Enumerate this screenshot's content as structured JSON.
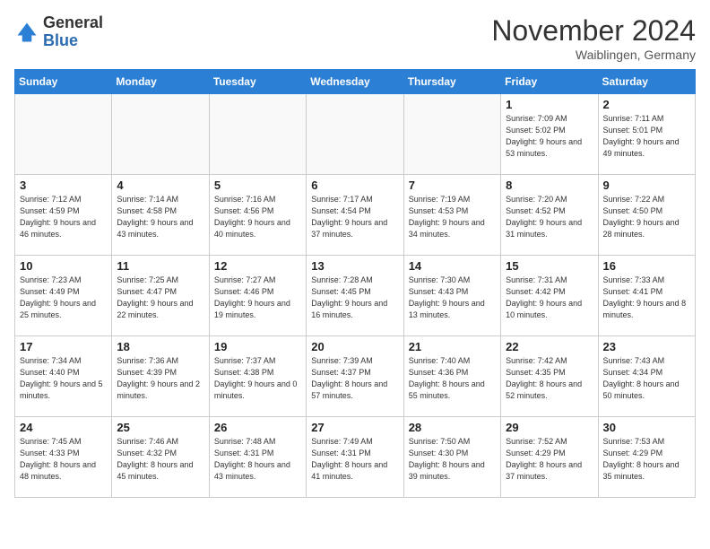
{
  "header": {
    "logo_general": "General",
    "logo_blue": "Blue",
    "month_title": "November 2024",
    "subtitle": "Waiblingen, Germany"
  },
  "weekdays": [
    "Sunday",
    "Monday",
    "Tuesday",
    "Wednesday",
    "Thursday",
    "Friday",
    "Saturday"
  ],
  "weeks": [
    [
      {
        "day": "",
        "info": ""
      },
      {
        "day": "",
        "info": ""
      },
      {
        "day": "",
        "info": ""
      },
      {
        "day": "",
        "info": ""
      },
      {
        "day": "",
        "info": ""
      },
      {
        "day": "1",
        "info": "Sunrise: 7:09 AM\nSunset: 5:02 PM\nDaylight: 9 hours\nand 53 minutes."
      },
      {
        "day": "2",
        "info": "Sunrise: 7:11 AM\nSunset: 5:01 PM\nDaylight: 9 hours\nand 49 minutes."
      }
    ],
    [
      {
        "day": "3",
        "info": "Sunrise: 7:12 AM\nSunset: 4:59 PM\nDaylight: 9 hours\nand 46 minutes."
      },
      {
        "day": "4",
        "info": "Sunrise: 7:14 AM\nSunset: 4:58 PM\nDaylight: 9 hours\nand 43 minutes."
      },
      {
        "day": "5",
        "info": "Sunrise: 7:16 AM\nSunset: 4:56 PM\nDaylight: 9 hours\nand 40 minutes."
      },
      {
        "day": "6",
        "info": "Sunrise: 7:17 AM\nSunset: 4:54 PM\nDaylight: 9 hours\nand 37 minutes."
      },
      {
        "day": "7",
        "info": "Sunrise: 7:19 AM\nSunset: 4:53 PM\nDaylight: 9 hours\nand 34 minutes."
      },
      {
        "day": "8",
        "info": "Sunrise: 7:20 AM\nSunset: 4:52 PM\nDaylight: 9 hours\nand 31 minutes."
      },
      {
        "day": "9",
        "info": "Sunrise: 7:22 AM\nSunset: 4:50 PM\nDaylight: 9 hours\nand 28 minutes."
      }
    ],
    [
      {
        "day": "10",
        "info": "Sunrise: 7:23 AM\nSunset: 4:49 PM\nDaylight: 9 hours\nand 25 minutes."
      },
      {
        "day": "11",
        "info": "Sunrise: 7:25 AM\nSunset: 4:47 PM\nDaylight: 9 hours\nand 22 minutes."
      },
      {
        "day": "12",
        "info": "Sunrise: 7:27 AM\nSunset: 4:46 PM\nDaylight: 9 hours\nand 19 minutes."
      },
      {
        "day": "13",
        "info": "Sunrise: 7:28 AM\nSunset: 4:45 PM\nDaylight: 9 hours\nand 16 minutes."
      },
      {
        "day": "14",
        "info": "Sunrise: 7:30 AM\nSunset: 4:43 PM\nDaylight: 9 hours\nand 13 minutes."
      },
      {
        "day": "15",
        "info": "Sunrise: 7:31 AM\nSunset: 4:42 PM\nDaylight: 9 hours\nand 10 minutes."
      },
      {
        "day": "16",
        "info": "Sunrise: 7:33 AM\nSunset: 4:41 PM\nDaylight: 9 hours\nand 8 minutes."
      }
    ],
    [
      {
        "day": "17",
        "info": "Sunrise: 7:34 AM\nSunset: 4:40 PM\nDaylight: 9 hours\nand 5 minutes."
      },
      {
        "day": "18",
        "info": "Sunrise: 7:36 AM\nSunset: 4:39 PM\nDaylight: 9 hours\nand 2 minutes."
      },
      {
        "day": "19",
        "info": "Sunrise: 7:37 AM\nSunset: 4:38 PM\nDaylight: 9 hours\nand 0 minutes."
      },
      {
        "day": "20",
        "info": "Sunrise: 7:39 AM\nSunset: 4:37 PM\nDaylight: 8 hours\nand 57 minutes."
      },
      {
        "day": "21",
        "info": "Sunrise: 7:40 AM\nSunset: 4:36 PM\nDaylight: 8 hours\nand 55 minutes."
      },
      {
        "day": "22",
        "info": "Sunrise: 7:42 AM\nSunset: 4:35 PM\nDaylight: 8 hours\nand 52 minutes."
      },
      {
        "day": "23",
        "info": "Sunrise: 7:43 AM\nSunset: 4:34 PM\nDaylight: 8 hours\nand 50 minutes."
      }
    ],
    [
      {
        "day": "24",
        "info": "Sunrise: 7:45 AM\nSunset: 4:33 PM\nDaylight: 8 hours\nand 48 minutes."
      },
      {
        "day": "25",
        "info": "Sunrise: 7:46 AM\nSunset: 4:32 PM\nDaylight: 8 hours\nand 45 minutes."
      },
      {
        "day": "26",
        "info": "Sunrise: 7:48 AM\nSunset: 4:31 PM\nDaylight: 8 hours\nand 43 minutes."
      },
      {
        "day": "27",
        "info": "Sunrise: 7:49 AM\nSunset: 4:31 PM\nDaylight: 8 hours\nand 41 minutes."
      },
      {
        "day": "28",
        "info": "Sunrise: 7:50 AM\nSunset: 4:30 PM\nDaylight: 8 hours\nand 39 minutes."
      },
      {
        "day": "29",
        "info": "Sunrise: 7:52 AM\nSunset: 4:29 PM\nDaylight: 8 hours\nand 37 minutes."
      },
      {
        "day": "30",
        "info": "Sunrise: 7:53 AM\nSunset: 4:29 PM\nDaylight: 8 hours\nand 35 minutes."
      }
    ]
  ]
}
